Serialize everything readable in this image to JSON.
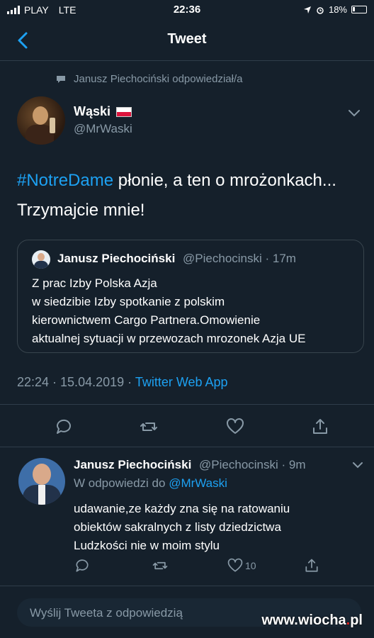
{
  "status_bar": {
    "carrier": "PLAY",
    "network": "LTE",
    "time": "22:36",
    "battery": "18%"
  },
  "nav": {
    "title": "Tweet",
    "back_icon": "chevron-left-icon"
  },
  "reply_context": {
    "text": "Janusz Piechociński odpowiedział/a"
  },
  "tweet": {
    "author_name": "Wąski",
    "author_handle": "@MrWaski",
    "text_hashtag": "#NotreDame",
    "text_line1_rest": " płonie, a ten o mrożonkach...",
    "text_line2": "Trzymajcie mnie!",
    "timestamp": "22:24 · 15.04.2019 · ",
    "source_app": "Twitter Web App"
  },
  "quoted_tweet": {
    "author_name": "Janusz Piechociński",
    "author_handle": "@Piechocinski · 17m",
    "lines": [
      "Z prac Izby Polska Azja",
      "w siedzibie Izby spotkanie z polskim",
      "kierownictwem Cargo Partnera.Omowienie",
      "aktualnej sytuacji w przewozach mrozonek Azja UE"
    ]
  },
  "reply": {
    "author_name": "Janusz Piechociński",
    "author_handle": "@Piechocinski · 9m",
    "reply_to_prefix": "W odpowiedzi do ",
    "reply_to_mention": "@MrWaski",
    "lines": [
      "udawanie,ze każdy zna się na ratowaniu",
      "obiektów sakralnych z listy dziedzictwa",
      "Ludzkości nie w moim stylu"
    ],
    "like_count": "10"
  },
  "compose": {
    "placeholder": "Wyślij Tweeta z odpowiedzią"
  },
  "watermark": {
    "site": "www.wiocha",
    "dot": ".",
    "tld": "pl"
  },
  "colors": {
    "background": "#15202b",
    "accent": "#1da1f2",
    "secondary_text": "#8899a6"
  }
}
